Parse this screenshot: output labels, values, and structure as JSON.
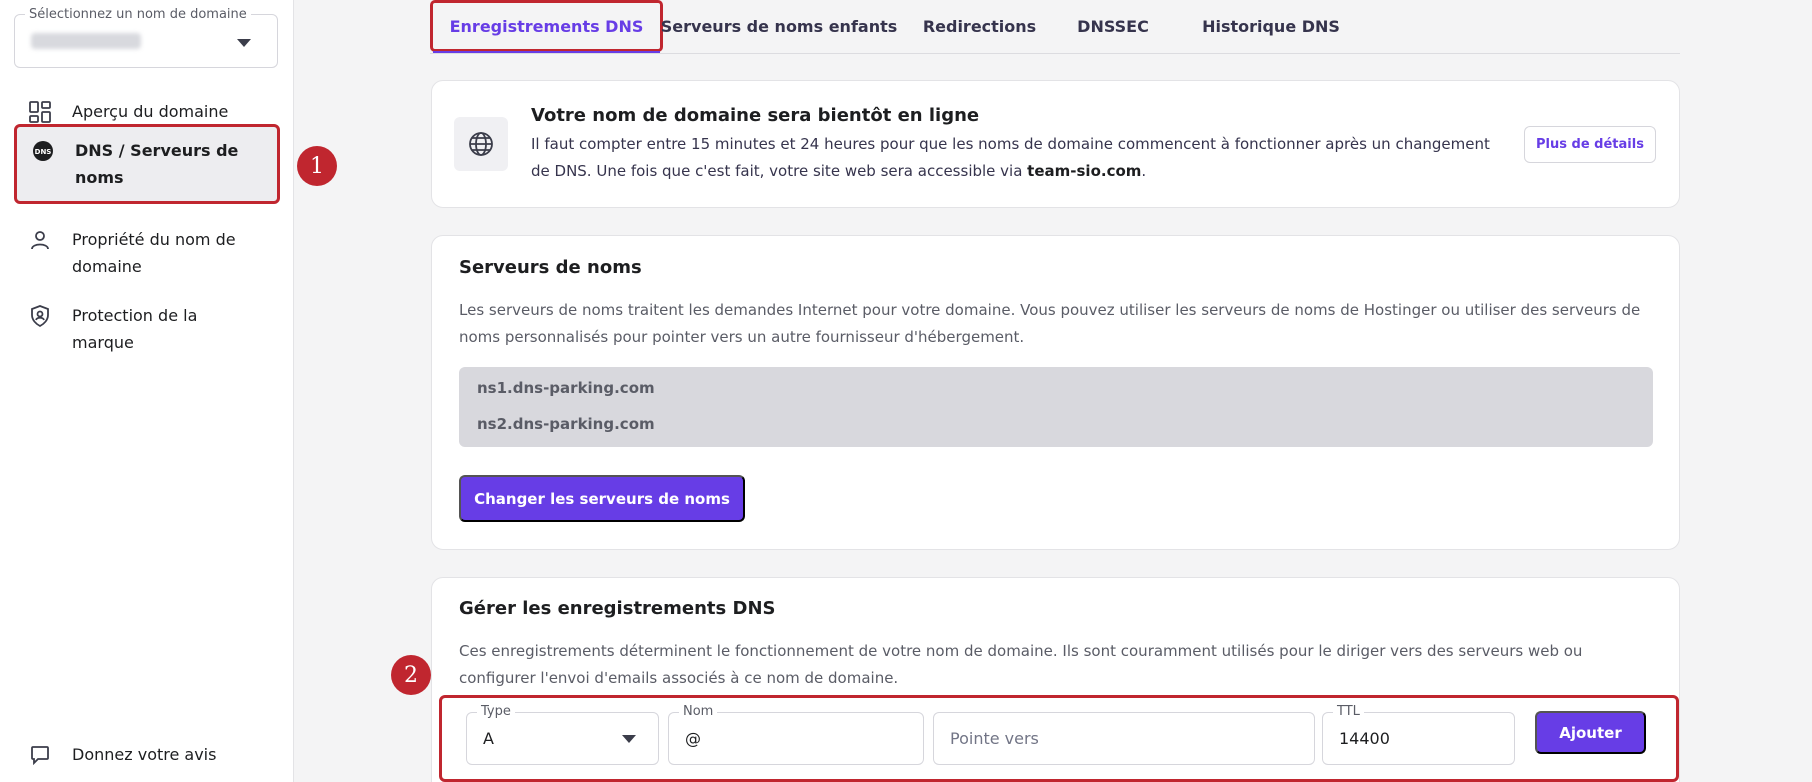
{
  "sidebar": {
    "domain_select": {
      "legend": "Sélectionnez un nom de domaine",
      "value": ""
    },
    "items": [
      {
        "label": "Aperçu du domaine",
        "icon": "dashboard-icon"
      },
      {
        "label": "DNS / Serveurs de noms",
        "icon": "dns-icon",
        "active": true
      },
      {
        "label": "Propriété du nom de domaine",
        "icon": "user-icon"
      },
      {
        "label": "Protection de la marque",
        "icon": "shield-icon"
      }
    ],
    "feedback": {
      "label": "Donnez votre avis",
      "icon": "chat-bubble-icon"
    }
  },
  "tabs": [
    {
      "label": "Enregistrements DNS",
      "active": true
    },
    {
      "label": "Serveurs de noms enfants"
    },
    {
      "label": "Redirections"
    },
    {
      "label": "DNSSEC"
    },
    {
      "label": "Historique DNS"
    }
  ],
  "info_banner": {
    "icon": "globe-icon",
    "title": "Votre nom de domaine sera bientôt en ligne",
    "text_before": "Il faut compter entre 15 minutes et 24 heures pour que les noms de domaine commencent à fonctionner après un changement de DNS. Une fois que c'est fait, votre site web sera accessible via ",
    "domain": "team-sio.com",
    "text_after": ".",
    "button": "Plus de détails"
  },
  "nameservers": {
    "title": "Serveurs de noms",
    "description": "Les serveurs de noms traitent les demandes Internet pour votre domaine. Vous pouvez utiliser les serveurs de noms de Hostinger ou utiliser des serveurs de noms personnalisés pour pointer vers un autre fournisseur d'hébergement.",
    "list": [
      "ns1.dns-parking.com",
      "ns2.dns-parking.com"
    ],
    "button": "Changer les serveurs de noms"
  },
  "dns_records": {
    "title": "Gérer les enregistrements DNS",
    "description": "Ces enregistrements déterminent le fonctionnement de votre nom de domaine. Ils sont couramment utilisés pour le diriger vers des serveurs web ou configurer l'envoi d'emails associés à ce nom de domaine.",
    "form": {
      "type_label": "Type",
      "type_value": "A",
      "name_label": "Nom",
      "name_value": "@",
      "points_placeholder": "Pointe vers",
      "ttl_label": "TTL",
      "ttl_value": "14400",
      "add_button": "Ajouter"
    }
  },
  "markers": [
    "1",
    "2"
  ],
  "colors": {
    "accent": "#673de6",
    "highlight": "#c0262f"
  }
}
